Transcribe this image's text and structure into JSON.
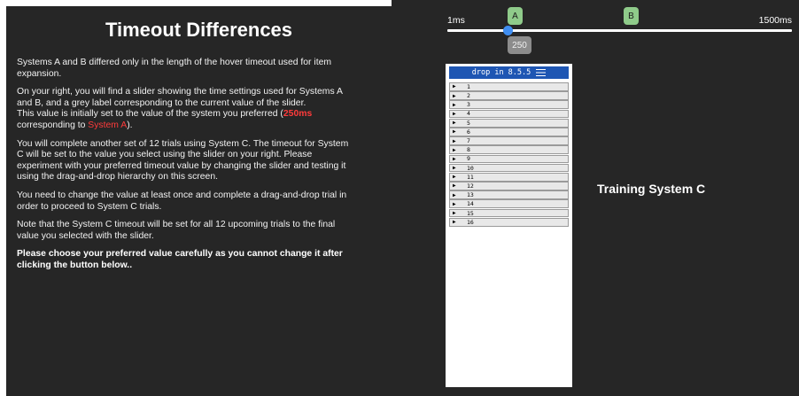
{
  "instructions": {
    "title": "Timeout Differences",
    "p1": [
      "Systems A and B differed only in the length of the hover timeout used for item",
      "expansion."
    ],
    "p2": [
      "On your right, you will find a slider showing the time settings used for Systems A",
      "and B, and a grey label corresponding to the current value of the slider.",
      "This value is initially set to the value of the system you preferred ("
    ],
    "p2_red1": "250ms",
    "p2_mid": "corresponding to ",
    "p2_red2": "System A",
    "p2_end": ").",
    "p3": [
      "You will complete another set of 12 trials using System C. The timeout for System",
      "C will be set to the value you select using the slider on your right. Please",
      "experiment with your preferred timeout value by changing the slider and testing it",
      "using the drag-and-drop hierarchy on this screen."
    ],
    "p4": [
      "You need to change the value at least once and complete a drag-and-drop trial in",
      "order to proceed to System C trials."
    ],
    "p5": [
      "Note that the System C timeout will be set for all 12 upcoming trials to the final",
      "value you selected with the slider."
    ],
    "p6": [
      "Please choose your preferred value carefully as you cannot change it after",
      "clicking the button below.."
    ]
  },
  "slider": {
    "min_label": "1ms",
    "max_label": "1500ms",
    "value_label": "250",
    "marker_a": "A",
    "marker_b": "B",
    "value": 250,
    "min": 1,
    "max": 1500
  },
  "tree": {
    "header": "drop in 8.5.5",
    "menu_icon": "hamburger-icon",
    "arrow_glyph": "▶",
    "items": [
      "1",
      "2",
      "3",
      "4",
      "5",
      "6",
      "7",
      "8",
      "9",
      "10",
      "11",
      "12",
      "13",
      "14",
      "15",
      "16"
    ]
  },
  "training_label": "Training System C",
  "colors": {
    "panel_bg": "#262626",
    "highlight_red": "#ff3b3b",
    "marker_green": "#8fcb8a",
    "handle_blue": "#3f8ef2",
    "tree_header_blue": "#1e56b3",
    "value_label_grey": "#8c8c8c"
  }
}
